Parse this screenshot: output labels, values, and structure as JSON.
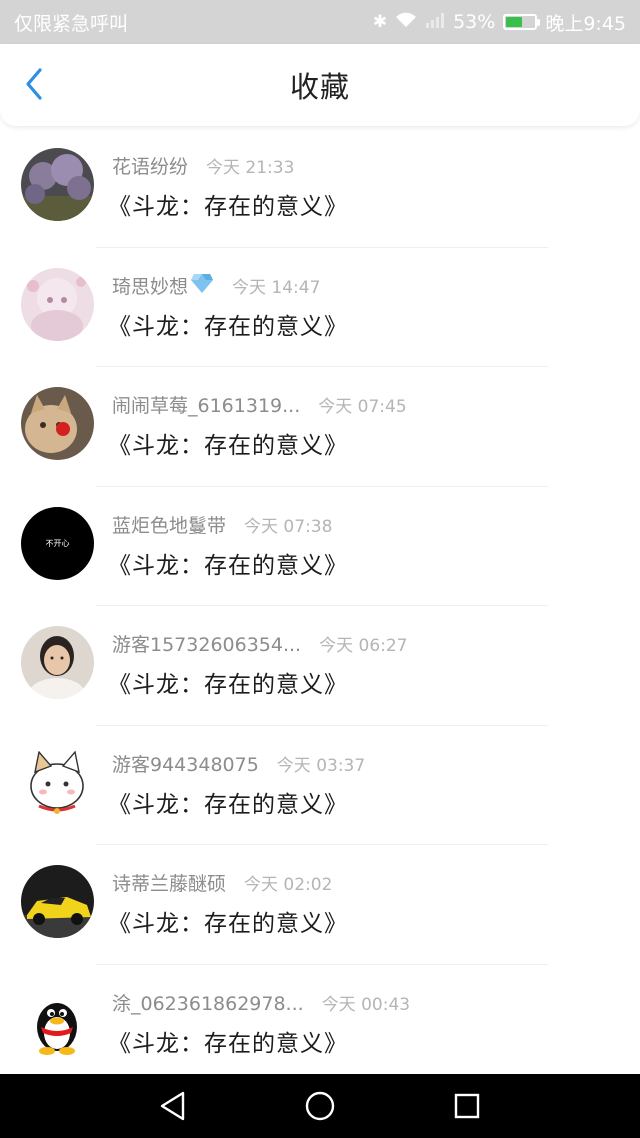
{
  "status_bar": {
    "carrier": "仅限紧急呼叫",
    "battery_percent": "53%",
    "battery_level": 0.53,
    "time": "晚上9:45",
    "icons": [
      "bluetooth-icon",
      "wifi-icon",
      "signal-icon",
      "battery-icon"
    ]
  },
  "header": {
    "title": "收藏",
    "back_icon": "chevron-left-icon",
    "accent_color": "#2b8fe6"
  },
  "items": [
    {
      "username": "花语纷纷",
      "time": "今天 21:33",
      "title": "《斗龙：存在的意义》",
      "avatar": "lavender-field-avatar"
    },
    {
      "username": "琦思妙想",
      "time": "今天 14:47",
      "title": "《斗龙：存在的意义》",
      "avatar": "anime-girl-avatar"
    },
    {
      "username": "闹闹草莓_6161319...",
      "time": "今天 07:45",
      "title": "《斗龙：存在的意义》",
      "avatar": "cat-avatar"
    },
    {
      "username": "蓝炬色地鬘带",
      "time": "今天 07:38",
      "title": "《斗龙：存在的意义》",
      "avatar": "black-text-avatar",
      "avatar_text": "不开心"
    },
    {
      "username": "游客15732606354...",
      "time": "今天 06:27",
      "title": "《斗龙：存在的意义》",
      "avatar": "person-avatar"
    },
    {
      "username": "游客944348075",
      "time": "今天 03:37",
      "title": "《斗龙：存在的意义》",
      "avatar": "cartoon-cat-avatar"
    },
    {
      "username": "诗蒂兰藤醚硕",
      "time": "今天 02:02",
      "title": "《斗龙：存在的意义》",
      "avatar": "yellow-car-avatar"
    },
    {
      "username": "涂_062361862978...",
      "time": "今天 00:43",
      "title": "《斗龙：存在的意义》",
      "avatar": "penguin-avatar"
    }
  ],
  "nav_bar": {
    "back": "triangle-back-icon",
    "home": "circle-home-icon",
    "recents": "square-recents-icon"
  }
}
